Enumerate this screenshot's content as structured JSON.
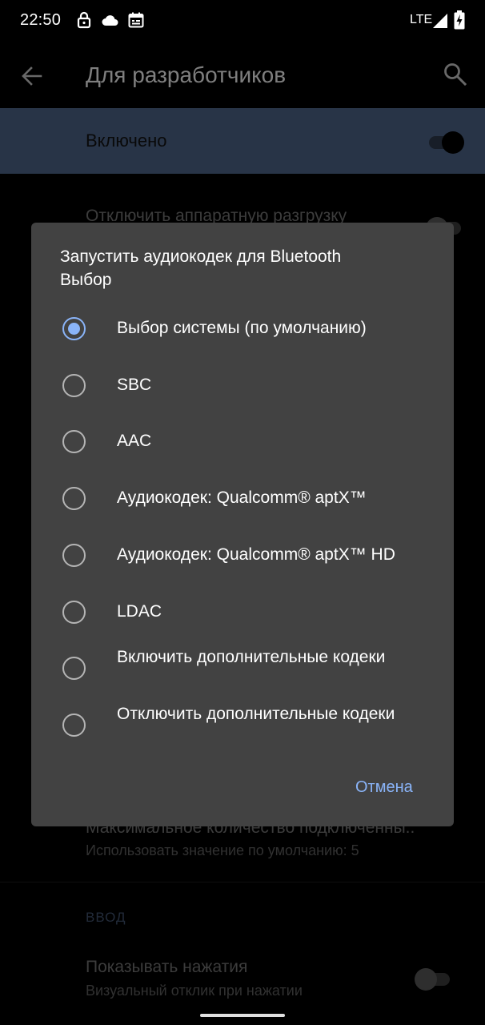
{
  "status_bar": {
    "time": "22:50",
    "network": "LTE",
    "icons": [
      "lock-icon",
      "cloud-icon",
      "calendar-icon",
      "signal-icon",
      "battery-charging-icon"
    ]
  },
  "app_bar": {
    "title": "Для разработчиков",
    "back_icon": "arrow-back-icon",
    "search_icon": "search-icon"
  },
  "master_switch": {
    "label": "Включено",
    "state": "on"
  },
  "background_list": {
    "item_hw_offload": "Отключить аппаратную разгрузку",
    "item_max_connections": "Максимальное количество подключенны..",
    "item_max_connections_sub": "Использовать значение по умолчанию: 5",
    "truncated_text": ".",
    "section_input": "ВВОД",
    "item_show_taps": "Показывать нажатия",
    "item_show_taps_sub": "Визуальный отклик при нажатии"
  },
  "dialog": {
    "title_line1": "Запустить аудиокодек для Bluetooth",
    "title_line2": "Выбор",
    "options": [
      {
        "label": "Выбор системы (по умолчанию)",
        "checked": true
      },
      {
        "label": "SBC",
        "checked": false
      },
      {
        "label": "AAC",
        "checked": false
      },
      {
        "label": "Аудиокодек: Qualcomm® aptX™",
        "checked": false
      },
      {
        "label": "Аудиокодек: Qualcomm® aptX™ HD",
        "checked": false
      },
      {
        "label": "LDAC",
        "checked": false
      },
      {
        "label": "Включить дополнительные кодеки",
        "checked": false
      },
      {
        "label": "Отключить дополнительные кодеки",
        "checked": false
      }
    ],
    "cancel_label": "Отмена"
  },
  "colors": {
    "accent": "#8ab4f8",
    "dialog_bg": "#424242",
    "master_bar_bg": "#4a5f82"
  }
}
